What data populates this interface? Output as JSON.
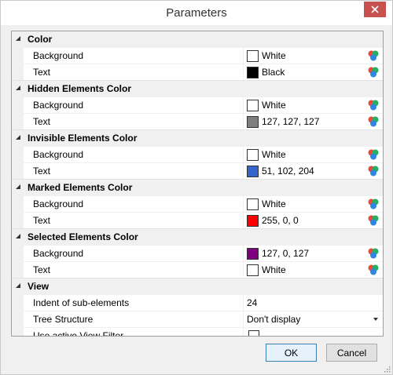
{
  "window": {
    "title": "Parameters"
  },
  "categories": [
    {
      "label": "Color",
      "props": [
        {
          "name": "Background",
          "swatch": "#ffffff",
          "value": "White"
        },
        {
          "name": "Text",
          "swatch": "#000000",
          "value": "Black"
        }
      ]
    },
    {
      "label": "Hidden Elements Color",
      "props": [
        {
          "name": "Background",
          "swatch": "#ffffff",
          "value": "White"
        },
        {
          "name": "Text",
          "swatch": "#7f7f7f",
          "value": "127, 127, 127"
        }
      ]
    },
    {
      "label": "Invisible Elements Color",
      "props": [
        {
          "name": "Background",
          "swatch": "#ffffff",
          "value": "White"
        },
        {
          "name": "Text",
          "swatch": "#3366cc",
          "value": "51, 102, 204"
        }
      ]
    },
    {
      "label": "Marked Elements Color",
      "props": [
        {
          "name": "Background",
          "swatch": "#ffffff",
          "value": "White"
        },
        {
          "name": "Text",
          "swatch": "#ff0000",
          "value": "255, 0, 0"
        }
      ]
    },
    {
      "label": "Selected Elements Color",
      "props": [
        {
          "name": "Background",
          "swatch": "#7f007f",
          "value": "127, 0, 127"
        },
        {
          "name": "Text",
          "swatch": "#ffffff",
          "value": "White"
        }
      ]
    },
    {
      "label": "View",
      "props": [
        {
          "name": "Indent of sub-elements",
          "value": "24"
        },
        {
          "name": "Tree Structure",
          "value": "Don't display"
        },
        {
          "name": "Use active View Filter",
          "checked": false
        }
      ]
    }
  ],
  "buttons": {
    "ok": "OK",
    "cancel": "Cancel"
  },
  "icons": {
    "close": "close-icon",
    "color_picker": "color-palette-icon",
    "collapse": "collapse-triangle-icon",
    "dropdown": "dropdown-arrow-icon"
  },
  "colors": {
    "close_button": "#c75050",
    "category_background": "#f0f0f0",
    "primary_button_border": "#3c7fb1"
  }
}
